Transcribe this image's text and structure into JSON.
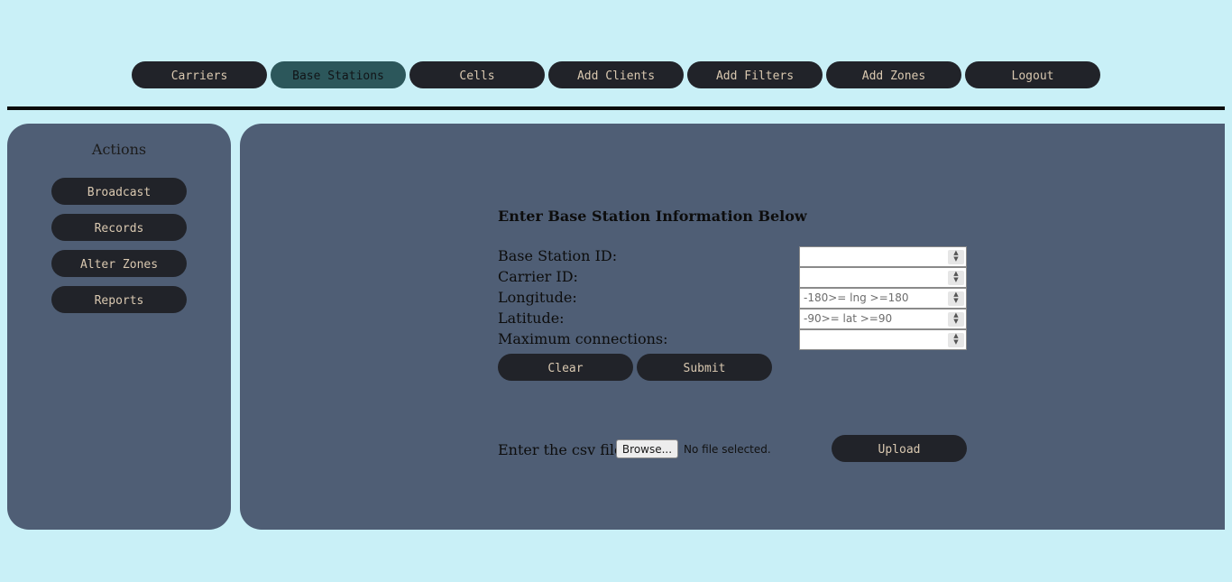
{
  "topnav": {
    "items": [
      {
        "label": "Carriers"
      },
      {
        "label": "Base Stations"
      },
      {
        "label": "Cells"
      },
      {
        "label": "Add Clients"
      },
      {
        "label": "Add Filters"
      },
      {
        "label": "Add Zones"
      },
      {
        "label": "Logout"
      }
    ],
    "active": "Base Stations"
  },
  "sidebar": {
    "title": "Actions",
    "items": [
      {
        "label": "Broadcast"
      },
      {
        "label": "Records"
      },
      {
        "label": "Alter Zones"
      },
      {
        "label": "Reports"
      }
    ]
  },
  "form": {
    "heading": "Enter Base Station Information Below",
    "fields": [
      {
        "label": "Base Station ID:",
        "value": "",
        "placeholder": ""
      },
      {
        "label": "Carrier ID:",
        "value": "",
        "placeholder": ""
      },
      {
        "label": "Longitude:",
        "value": "",
        "placeholder": "-180>= lng >=180"
      },
      {
        "label": "Latitude:",
        "value": "",
        "placeholder": "-90>= lat >=90"
      },
      {
        "label": "Maximum connections:",
        "value": "",
        "placeholder": ""
      }
    ],
    "clear_label": "Clear",
    "submit_label": "Submit"
  },
  "upload": {
    "label": "Enter the csv file",
    "browse_label": "Browse...",
    "file_status": "No file selected.",
    "upload_label": "Upload"
  },
  "colors": {
    "background": "#c9f0f7",
    "panel": "#4f5e75",
    "button": "#212329",
    "button_text": "#d9c8b0",
    "active_tab": "#2c575b"
  }
}
